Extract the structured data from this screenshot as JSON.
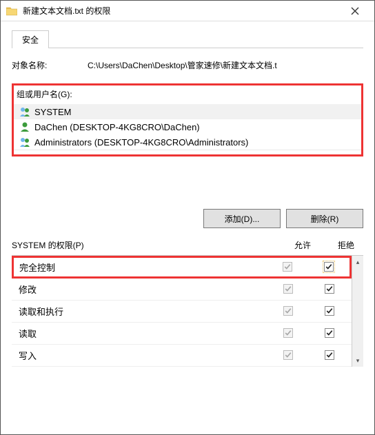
{
  "window": {
    "title": "新建文本文档.txt 的权限"
  },
  "tabs": {
    "security": "安全"
  },
  "object": {
    "label": "对象名称:",
    "path": "C:\\Users\\DaChen\\Desktop\\管家速修\\新建文本文档.t"
  },
  "groups": {
    "label": "组或用户名(G):",
    "items": [
      {
        "name": "SYSTEM",
        "icon": "group"
      },
      {
        "name": "DaChen (DESKTOP-4KG8CRO\\DaChen)",
        "icon": "user"
      },
      {
        "name": "Administrators (DESKTOP-4KG8CRO\\Administrators)",
        "icon": "group"
      }
    ]
  },
  "buttons": {
    "add": "添加(D)...",
    "remove": "删除(R)"
  },
  "perms": {
    "label": "SYSTEM 的权限(P)",
    "allow_hdr": "允许",
    "deny_hdr": "拒绝",
    "rows": [
      {
        "name": "完全控制",
        "allow": true,
        "allow_disabled": true,
        "deny": true,
        "hl": true
      },
      {
        "name": "修改",
        "allow": true,
        "allow_disabled": true,
        "deny": true
      },
      {
        "name": "读取和执行",
        "allow": true,
        "allow_disabled": true,
        "deny": true
      },
      {
        "name": "读取",
        "allow": true,
        "allow_disabled": true,
        "deny": true
      },
      {
        "name": "写入",
        "allow": true,
        "allow_disabled": true,
        "deny": true
      }
    ]
  }
}
